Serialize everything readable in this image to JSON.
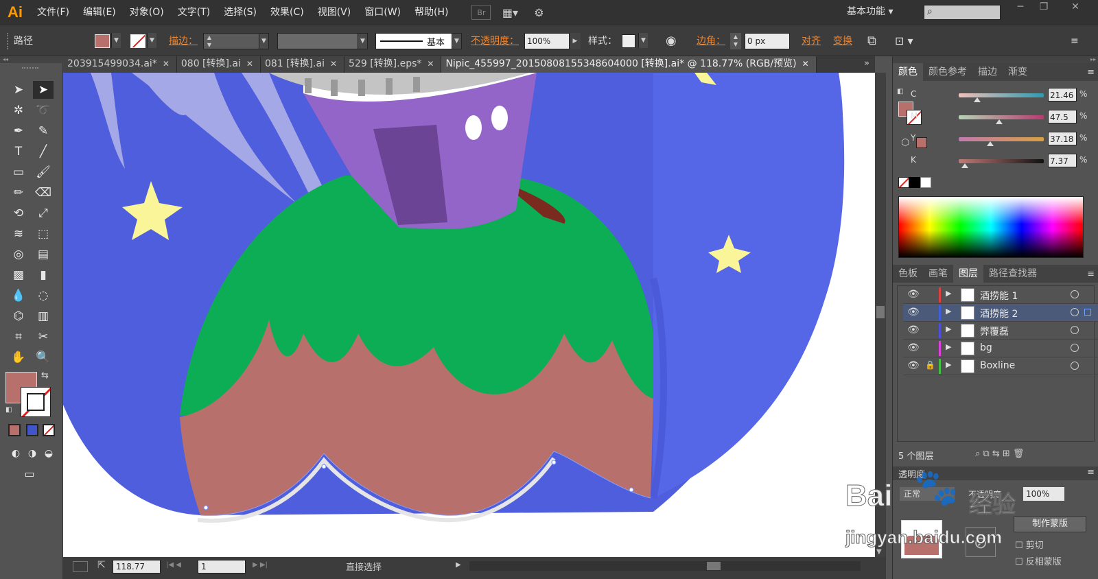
{
  "app": {
    "logo": "Ai"
  },
  "menu": [
    "文件(F)",
    "编辑(E)",
    "对象(O)",
    "文字(T)",
    "选择(S)",
    "效果(C)",
    "视图(V)",
    "窗口(W)",
    "帮助(H)"
  ],
  "menu_icons": {
    "bridge": "Br"
  },
  "workspace": "基本功能",
  "search_icon": "search-icon",
  "window_buttons": [
    "─",
    "❐",
    "✕"
  ],
  "control": {
    "selection_label": "路径",
    "stroke_label": "描边：",
    "stroke_style": "基本",
    "opacity_label": "不透明度：",
    "opacity_value": "100%",
    "style_label": "样式：",
    "corner_label": "边角：",
    "corner_value": "0 px",
    "align_label": "对齐",
    "transform_label": "变换",
    "fill_color": "#b8706c"
  },
  "tabs": [
    {
      "label": "203915499034.ai*",
      "active": false
    },
    {
      "label": "080 [转换].ai",
      "active": false
    },
    {
      "label": "081 [转换].ai",
      "active": false
    },
    {
      "label": "529 [转换].eps*",
      "active": false
    },
    {
      "label": "Nipic_455997_20150808155348604000 [转换].ai* @ 118.77% (RGB/预览)",
      "active": true
    }
  ],
  "color_panel": {
    "tabs": [
      "颜色",
      "颜色参考",
      "描边",
      "渐变"
    ],
    "channels": [
      {
        "name": "C",
        "value": "21.46",
        "pos": 0.2146
      },
      {
        "name": "M",
        "value": "47.5",
        "pos": 0.475
      },
      {
        "name": "Y",
        "value": "37.18",
        "pos": 0.3718
      },
      {
        "name": "K",
        "value": "7.37",
        "pos": 0.0737
      }
    ],
    "percent": "%"
  },
  "layers_panel": {
    "tabs": [
      "色板",
      "画笔",
      "图层",
      "路径查找器"
    ],
    "layers": [
      {
        "name": "酒捞能 1",
        "color": "#e04040",
        "locked": false,
        "selected": false
      },
      {
        "name": "酒捞能 2",
        "color": "#4060e0",
        "locked": false,
        "selected": true
      },
      {
        "name": "弊覆磊",
        "color": "#5050e0",
        "locked": false,
        "selected": false
      },
      {
        "name": "bg",
        "color": "#e040e0",
        "locked": false,
        "selected": false
      },
      {
        "name": "Boxline",
        "color": "#40c040",
        "locked": true,
        "selected": false
      }
    ],
    "count": "5 个图层"
  },
  "transparency_panel": {
    "title": "透明度",
    "mode": "正常",
    "opacity_label": "不透明度",
    "opacity_value": "100%",
    "make_mask": "制作蒙版",
    "clip": "剪切",
    "invert_mask": "反相蒙版"
  },
  "status": {
    "zoom": "118.77",
    "page": "1",
    "tool": "直接选择"
  },
  "watermark": {
    "brand": "Bai",
    "brand2": "经验",
    "url": "jingyan.baidu.com"
  }
}
